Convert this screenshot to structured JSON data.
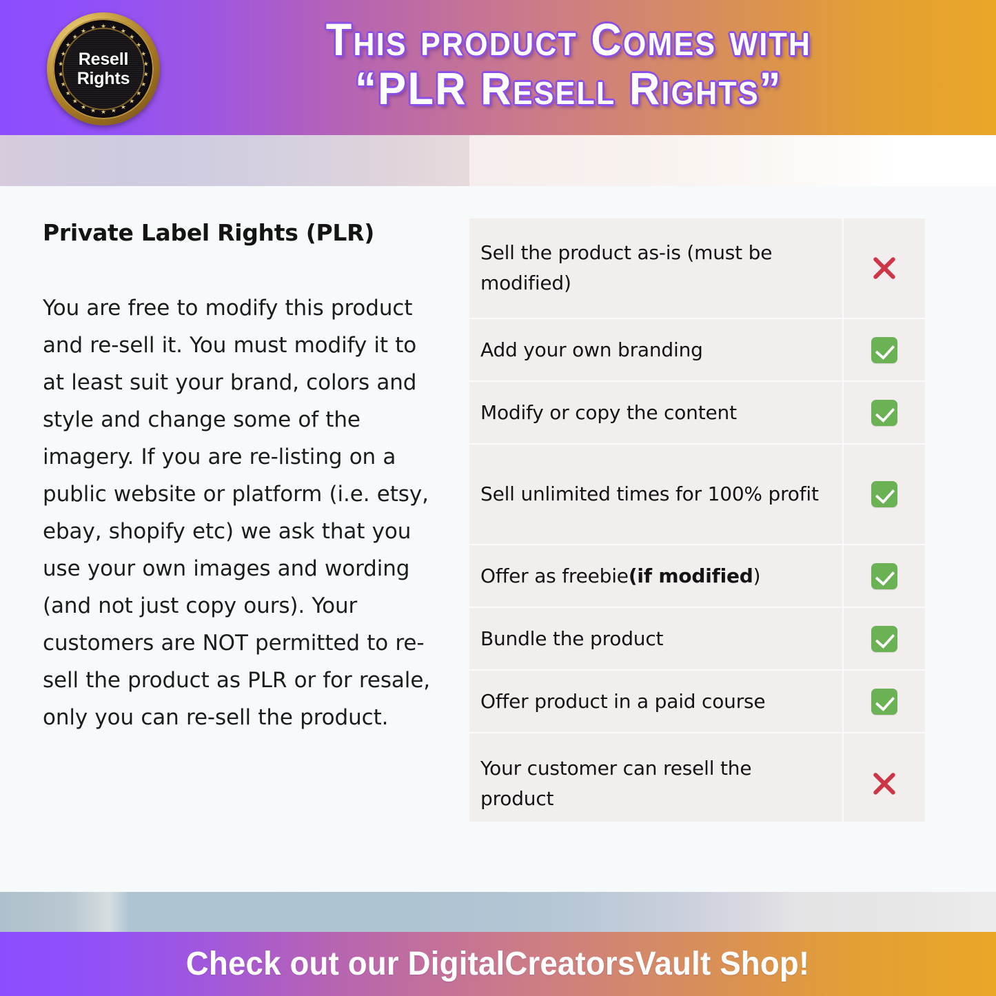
{
  "header": {
    "seal": {
      "line1": "Resell",
      "line2": "Rights",
      "star_count": 26
    },
    "title_line1": "This product Comes with",
    "title_line2": "“PLR Resell Rights”",
    "gradient_start": "#8C4DFF",
    "gradient_end": "#E9A627"
  },
  "main": {
    "heading": "Private Label Rights (PLR)",
    "body": "You are free to modify this product and re-sell it. You must modify it to at least suit your brand, colors and style and change some of the imagery.  If you are re-listing on a public website or platform (i.e. etsy, ebay, shopify etc) we ask that you use your own images and wording (and not just copy ours). Your customers are NOT permitted to re-sell the product as PLR or for resale, only you can re-sell the product."
  },
  "permissions_table": {
    "background": "#F2EEEE",
    "check_color": "#6BB254",
    "cross_color": "#CC3647",
    "rows": [
      {
        "label": "Sell the product as-is (must be modified)",
        "label_bold": "",
        "label_tail": "",
        "allowed": false,
        "icon": "cross-icon",
        "lines": 2
      },
      {
        "label": "Add your own branding",
        "label_bold": "",
        "label_tail": "",
        "allowed": true,
        "icon": "check-icon",
        "lines": 1
      },
      {
        "label": "Modify or copy the content",
        "label_bold": "",
        "label_tail": "",
        "allowed": true,
        "icon": "check-icon",
        "lines": 1
      },
      {
        "label": "Sell unlimited times for 100% profit",
        "label_bold": "",
        "label_tail": "",
        "allowed": true,
        "icon": "check-icon",
        "lines": 2
      },
      {
        "label": "Offer as freebie ",
        "label_bold": "(if modified",
        "label_tail": ")",
        "allowed": true,
        "icon": "check-icon",
        "lines": 1
      },
      {
        "label": "Bundle the product",
        "label_bold": "",
        "label_tail": "",
        "allowed": true,
        "icon": "check-icon",
        "lines": 1
      },
      {
        "label": "Offer product in a paid course",
        "label_bold": "",
        "label_tail": "",
        "allowed": true,
        "icon": "check-icon",
        "lines": 1
      },
      {
        "label": "Your customer can resell the product",
        "label_bold": "",
        "label_tail": "",
        "allowed": false,
        "icon": "cross-icon",
        "lines": 2
      }
    ]
  },
  "footer": {
    "cta": "Check out our DigitalCreatorsVault Shop!"
  }
}
